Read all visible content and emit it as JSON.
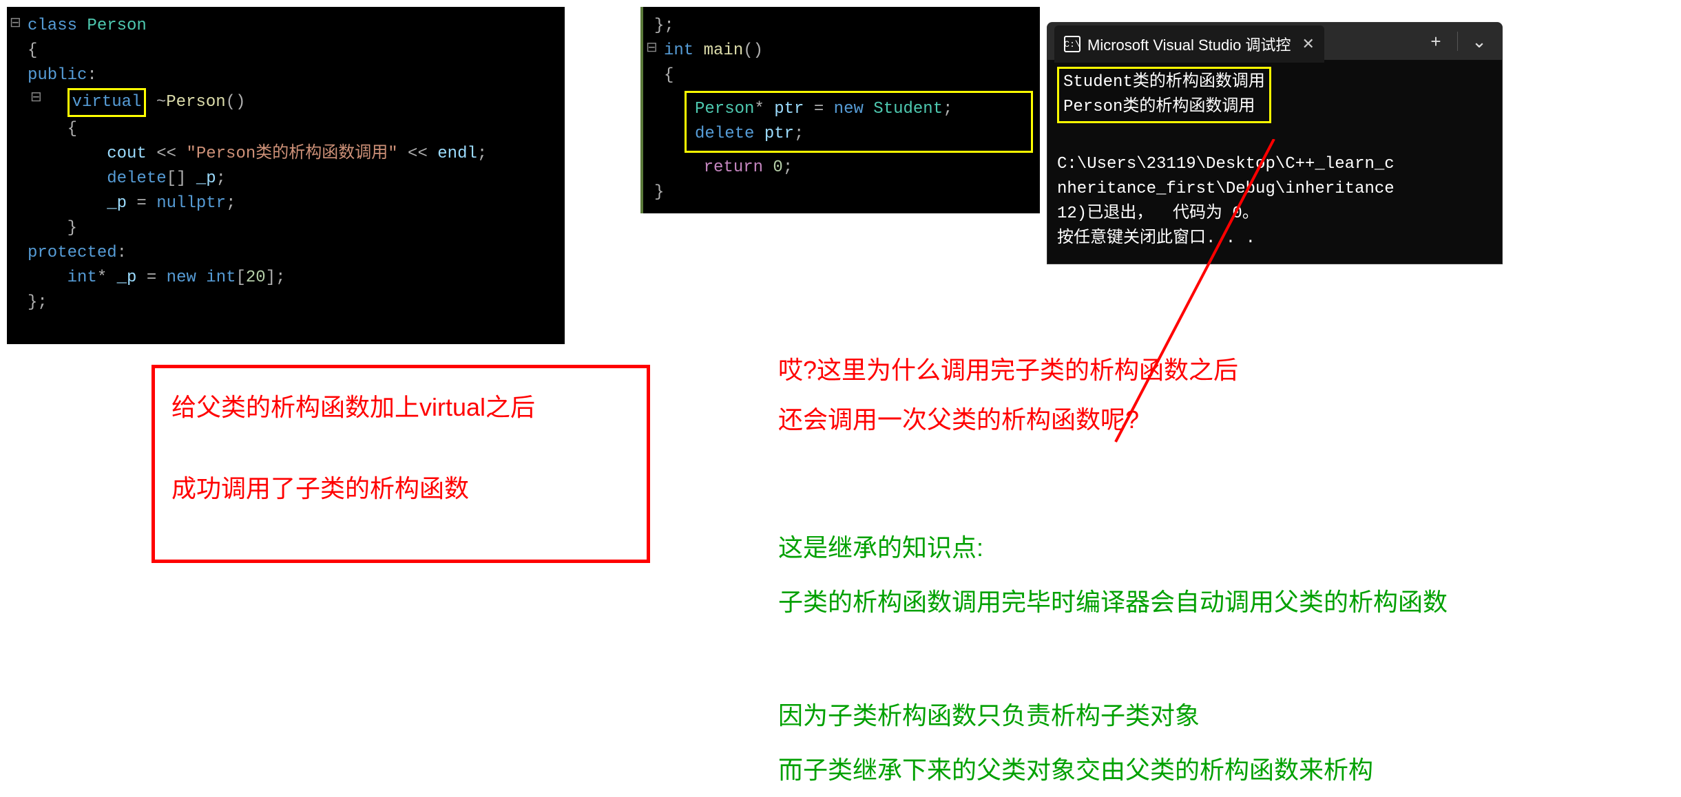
{
  "left_code": {
    "l1_class": "class",
    "l1_name": "Person",
    "l2_brace": "{",
    "l3_public": "public",
    "l3_colon": ":",
    "l4_virtual": "virtual",
    "l4_tilde": "~",
    "l4_dtor": "Person",
    "l4_paren": "()",
    "l5_brace": "{",
    "l6_cout": "cout",
    "l6_ins": " << ",
    "l6_str": "\"Person类的析构函数调用\"",
    "l6_ins2": " << ",
    "l6_endl": "endl",
    "l6_semi": ";",
    "l7_delete": "delete",
    "l7_brackets": "[]",
    "l7_p": " _p",
    "l7_semi": ";",
    "l8_p": "_p",
    "l8_eq": " = ",
    "l8_null": "nullptr",
    "l8_semi": ";",
    "l9_brace": "}",
    "l10_protected": "protected",
    "l10_colon": ":",
    "l11_int": "int",
    "l11_star": "* ",
    "l11_p": "_p",
    "l11_eq": " = ",
    "l11_new": "new",
    "l11_int2": " int",
    "l11_br_open": "[",
    "l11_num": "20",
    "l11_br_close": "]",
    "l11_semi": ";",
    "l12_brace": "};"
  },
  "right_code": {
    "l0_brace": "};",
    "l1_int": "int",
    "l1_main": " main",
    "l1_paren": "()",
    "l2_brace": "{",
    "l3_type": "Person",
    "l3_star": "* ",
    "l3_ptr": "ptr",
    "l3_eq": " = ",
    "l3_new": "new",
    "l3_student": " Student",
    "l3_semi": ";",
    "l4_delete": "delete",
    "l4_ptr": " ptr",
    "l4_semi": ";",
    "l5_return": "return",
    "l5_zero": " 0",
    "l5_semi": ";",
    "l6_brace": "}"
  },
  "console": {
    "title": "Microsoft Visual Studio 调试控",
    "icon_text": "C:\\",
    "out_line1": "Student类的析构函数调用",
    "out_line2": "Person类的析构函数调用",
    "path_line1": "C:\\Users\\23119\\Desktop\\C++_learn_c",
    "path_line2": "nheritance_first\\Debug\\inheritance",
    "exit_line": "12)已退出，  代码为 0。",
    "close_line": "按任意键关闭此窗口. . ."
  },
  "red_box": {
    "line1": "给父类的析构函数加上virtual之后",
    "line2": "成功调用了子类的析构函数"
  },
  "red_question": {
    "line1": "哎?这里为什么调用完子类的析构函数之后",
    "line2": "还会调用一次父类的析构函数呢?"
  },
  "green1": {
    "line1": "这是继承的知识点:",
    "line2": "子类的析构函数调用完毕时编译器会自动调用父类的析构函数"
  },
  "green2": {
    "line1": "因为子类析构函数只负责析构子类对象",
    "line2": "而子类继承下来的父类对象交由父类的析构函数来析构"
  }
}
